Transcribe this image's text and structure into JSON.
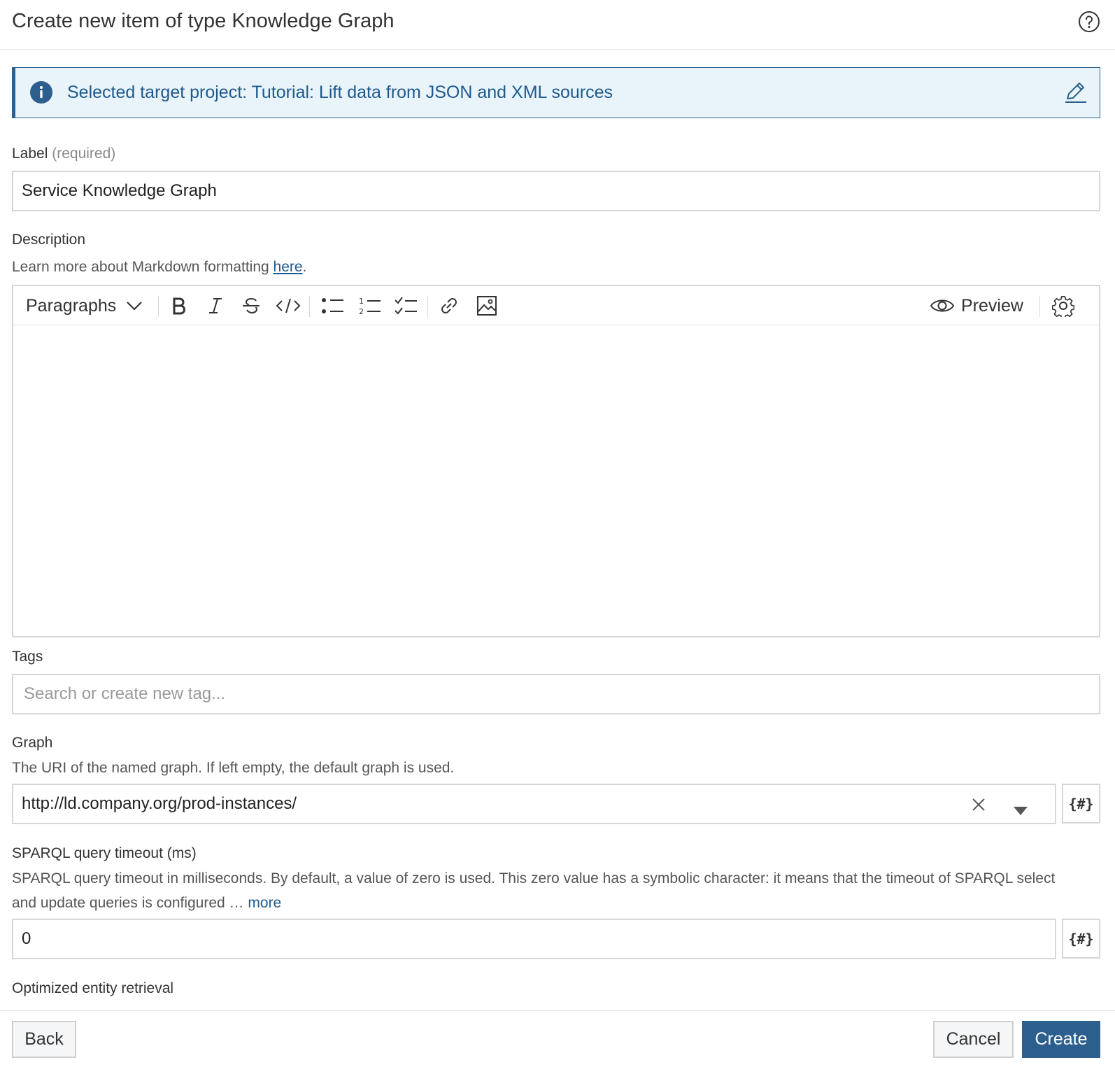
{
  "dialog": {
    "title": "Create new item of type Knowledge Graph",
    "help_icon": "help-circle-icon"
  },
  "notice": {
    "icon": "info-icon",
    "text": "Selected target project: Tutorial: Lift data from JSON and XML sources",
    "edit_icon": "pencil-icon",
    "color": "#2c5f8d"
  },
  "label_field": {
    "label": "Label",
    "required_hint": "(required)",
    "value": "Service Knowledge Graph"
  },
  "description_field": {
    "label": "Description",
    "help_prefix": "Learn more about Markdown formatting ",
    "help_link": "here",
    "help_suffix": ".",
    "value": ""
  },
  "editor_toolbar": {
    "paragraph_select": "Paragraphs",
    "preview_label": "Preview",
    "tools": [
      "bold",
      "italic",
      "strikethrough",
      "code",
      "bulleted-list",
      "numbered-list",
      "checklist",
      "link",
      "image",
      "settings"
    ]
  },
  "tags_field": {
    "label": "Tags",
    "placeholder": "Search or create new tag..."
  },
  "graph_field": {
    "label": "Graph",
    "help": "The URI of the named graph. If left empty, the default graph is used.",
    "value": "http://ld.company.org/prod-instances/",
    "var_button": "{#}"
  },
  "timeout_field": {
    "label": "SPARQL query timeout (ms)",
    "help_line1": "SPARQL query timeout in milliseconds. By default, a value of zero is used. This zero value has a symbolic character: it means that the timeout of SPARQL select",
    "help_line2": "and update queries is configured … ",
    "more_link": "more",
    "value": "0",
    "var_button": "{#}"
  },
  "next_field": {
    "label": "Optimized entity retrieval"
  },
  "footer": {
    "back": "Back",
    "cancel": "Cancel",
    "create": "Create",
    "primary_color": "#2c5f8d"
  }
}
